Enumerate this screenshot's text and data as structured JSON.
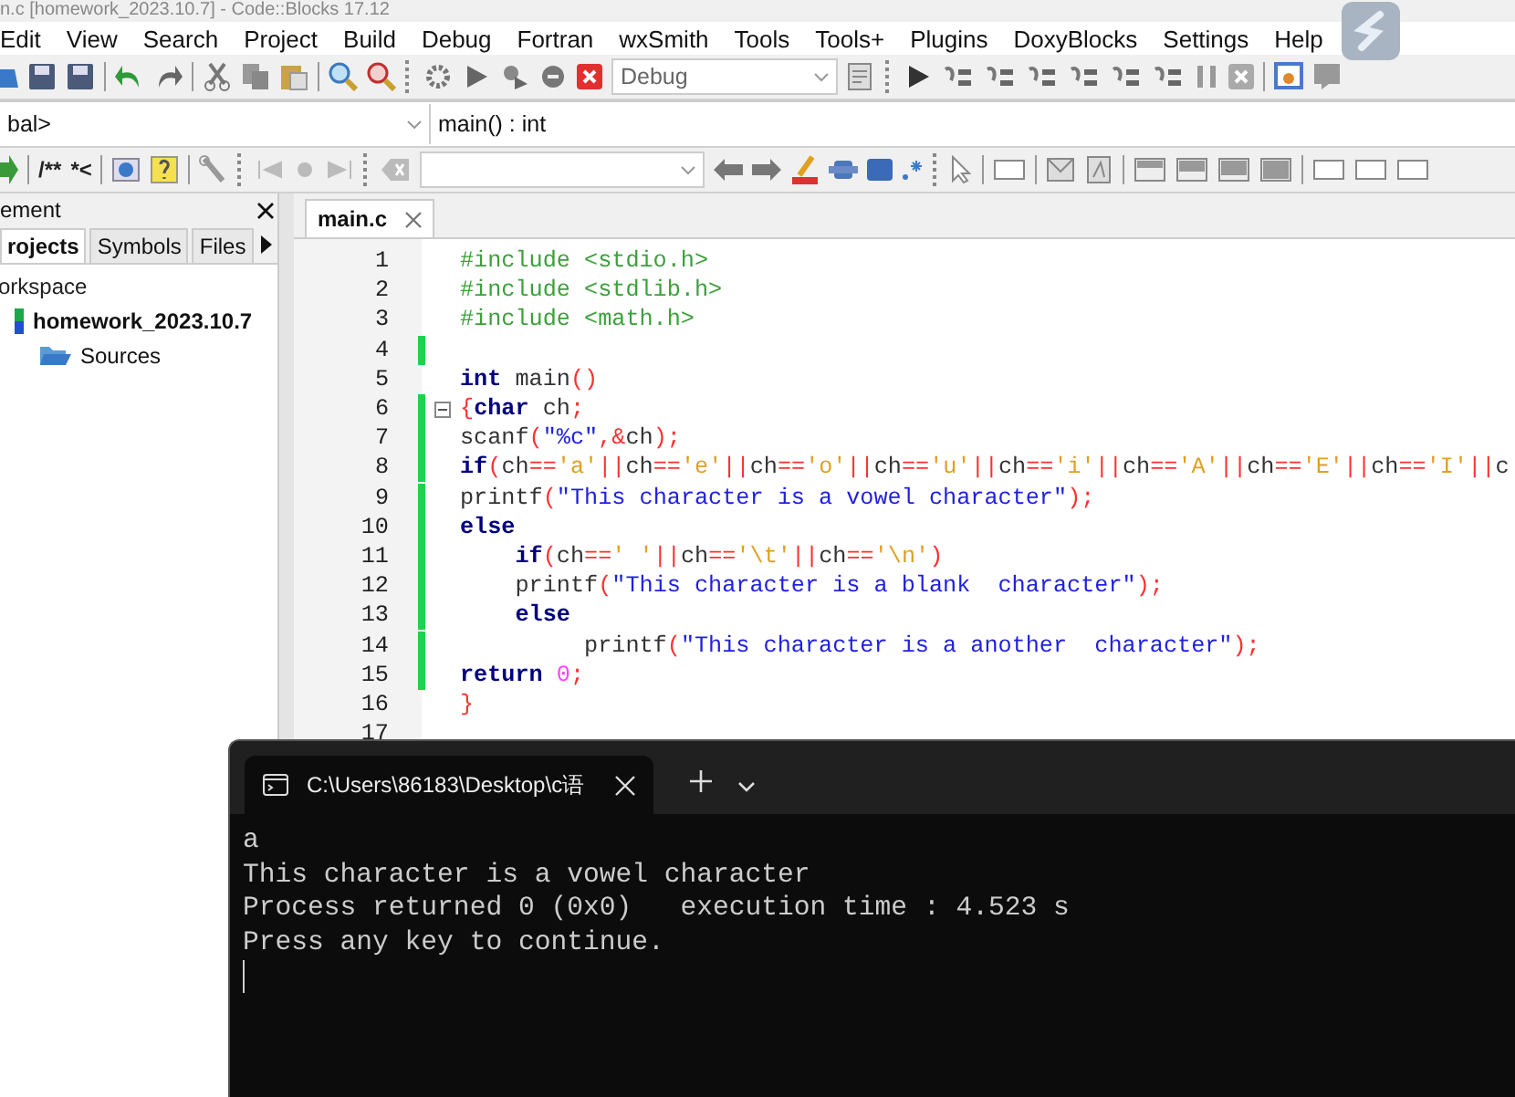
{
  "window": {
    "title": "n.c [homework_2023.10.7] - Code::Blocks 17.12"
  },
  "menu": [
    "Edit",
    "View",
    "Search",
    "Project",
    "Build",
    "Debug",
    "Fortran",
    "wxSmith",
    "Tools",
    "Tools+",
    "Plugins",
    "DoxyBlocks",
    "Settings",
    "Help"
  ],
  "toolbar": {
    "build_target": "Debug",
    "scope": "bal>",
    "function": "main() : int",
    "doxy_buttons": [
      "/**",
      "*<"
    ]
  },
  "management": {
    "title": "ement",
    "tabs": [
      {
        "label": "rojects",
        "selected": true
      },
      {
        "label": "Symbols",
        "selected": false
      },
      {
        "label": "Files",
        "selected": false
      }
    ],
    "tree": [
      {
        "label": "orkspace",
        "kind": "workspace",
        "children": [
          {
            "label": "homework_2023.10.7",
            "kind": "project",
            "children": [
              {
                "label": "Sources",
                "kind": "folder"
              }
            ]
          }
        ]
      }
    ]
  },
  "editor": {
    "tabs": [
      {
        "label": "main.c",
        "selected": true
      }
    ],
    "lines": [
      {
        "n": "1",
        "changed": false,
        "fold": false,
        "tokens": [
          {
            "t": "#include <stdio.h>",
            "kind": "pp"
          }
        ]
      },
      {
        "n": "2",
        "changed": false,
        "fold": false,
        "tokens": [
          {
            "t": "#include <stdlib.h>",
            "kind": "pp"
          }
        ]
      },
      {
        "n": "3",
        "changed": false,
        "fold": false,
        "tokens": [
          {
            "t": "#include <math.h>",
            "kind": "pp"
          }
        ]
      },
      {
        "n": "4",
        "changed": true,
        "fold": false
      },
      {
        "n": "5",
        "changed": false,
        "fold": false,
        "tokens": [
          {
            "t": "int",
            "kind": "kw"
          },
          {
            "t": " main",
            "kind": "tx"
          },
          {
            "t": "()",
            "kind": "op"
          }
        ]
      },
      {
        "n": "6",
        "changed": true,
        "fold": true,
        "tokens": [
          {
            "t": "{",
            "kind": "op"
          },
          {
            "t": "char",
            "kind": "kw"
          },
          {
            "t": " ch",
            "kind": "tx"
          },
          {
            "t": ";",
            "kind": "op"
          }
        ]
      },
      {
        "n": "7",
        "changed": true,
        "fold": false,
        "tokens": [
          {
            "t": "scanf",
            "kind": "tx"
          },
          {
            "t": "(",
            "kind": "op"
          },
          {
            "t": "\"%c\"",
            "kind": "str"
          },
          {
            "t": ",&",
            "kind": "op"
          },
          {
            "t": "ch",
            "kind": "tx"
          },
          {
            "t": ");",
            "kind": "op"
          }
        ]
      },
      {
        "n": "8",
        "changed": true,
        "fold": false,
        "tokens": [
          {
            "t": "if",
            "kind": "kw"
          },
          {
            "t": "(",
            "kind": "op"
          },
          {
            "t": "ch",
            "kind": "tx"
          },
          {
            "t": "==",
            "kind": "op"
          },
          {
            "t": "'a'",
            "kind": "chr"
          },
          {
            "t": "||",
            "kind": "op"
          },
          {
            "t": "ch",
            "kind": "tx"
          },
          {
            "t": "==",
            "kind": "op"
          },
          {
            "t": "'e'",
            "kind": "chr"
          },
          {
            "t": "||",
            "kind": "op"
          },
          {
            "t": "ch",
            "kind": "tx"
          },
          {
            "t": "==",
            "kind": "op"
          },
          {
            "t": "'o'",
            "kind": "chr"
          },
          {
            "t": "||",
            "kind": "op"
          },
          {
            "t": "ch",
            "kind": "tx"
          },
          {
            "t": "==",
            "kind": "op"
          },
          {
            "t": "'u'",
            "kind": "chr"
          },
          {
            "t": "||",
            "kind": "op"
          },
          {
            "t": "ch",
            "kind": "tx"
          },
          {
            "t": "==",
            "kind": "op"
          },
          {
            "t": "'i'",
            "kind": "chr"
          },
          {
            "t": "||",
            "kind": "op"
          },
          {
            "t": "ch",
            "kind": "tx"
          },
          {
            "t": "==",
            "kind": "op"
          },
          {
            "t": "'A'",
            "kind": "chr"
          },
          {
            "t": "||",
            "kind": "op"
          },
          {
            "t": "ch",
            "kind": "tx"
          },
          {
            "t": "==",
            "kind": "op"
          },
          {
            "t": "'E'",
            "kind": "chr"
          },
          {
            "t": "||",
            "kind": "op"
          },
          {
            "t": "ch",
            "kind": "tx"
          },
          {
            "t": "==",
            "kind": "op"
          },
          {
            "t": "'I'",
            "kind": "chr"
          },
          {
            "t": "||",
            "kind": "op"
          },
          {
            "t": "c",
            "kind": "tx"
          }
        ]
      },
      {
        "n": "9",
        "changed": true,
        "fold": false,
        "tokens": [
          {
            "t": "printf",
            "kind": "tx"
          },
          {
            "t": "(",
            "kind": "op"
          },
          {
            "t": "\"This character is a vowel character\"",
            "kind": "str"
          },
          {
            "t": ");",
            "kind": "op"
          }
        ]
      },
      {
        "n": "10",
        "changed": true,
        "fold": false,
        "tokens": [
          {
            "t": "else",
            "kind": "kw"
          }
        ]
      },
      {
        "n": "11",
        "changed": true,
        "fold": false,
        "tokens": [
          {
            "t": "    if",
            "kind": "kw"
          },
          {
            "t": "(",
            "kind": "op"
          },
          {
            "t": "ch",
            "kind": "tx"
          },
          {
            "t": "==",
            "kind": "op"
          },
          {
            "t": "' '",
            "kind": "chr"
          },
          {
            "t": "||",
            "kind": "op"
          },
          {
            "t": "ch",
            "kind": "tx"
          },
          {
            "t": "==",
            "kind": "op"
          },
          {
            "t": "'\\t'",
            "kind": "chr"
          },
          {
            "t": "||",
            "kind": "op"
          },
          {
            "t": "ch",
            "kind": "tx"
          },
          {
            "t": "==",
            "kind": "op"
          },
          {
            "t": "'\\n'",
            "kind": "chr"
          },
          {
            "t": ")",
            "kind": "op"
          }
        ]
      },
      {
        "n": "12",
        "changed": true,
        "fold": false,
        "tokens": [
          {
            "t": "    printf",
            "kind": "tx"
          },
          {
            "t": "(",
            "kind": "op"
          },
          {
            "t": "\"This character is a blank  character\"",
            "kind": "str"
          },
          {
            "t": ");",
            "kind": "op"
          }
        ]
      },
      {
        "n": "13",
        "changed": true,
        "fold": false,
        "tokens": [
          {
            "t": "    else",
            "kind": "kw"
          }
        ]
      },
      {
        "n": "14",
        "changed": true,
        "fold": false,
        "tokens": [
          {
            "t": "         printf",
            "kind": "tx"
          },
          {
            "t": "(",
            "kind": "op"
          },
          {
            "t": "\"This character is a another  character\"",
            "kind": "str"
          },
          {
            "t": ");",
            "kind": "op"
          }
        ]
      },
      {
        "n": "15",
        "changed": true,
        "fold": false,
        "tokens": [
          {
            "t": "return",
            "kind": "kw"
          },
          {
            "t": " 0",
            "kind": "num"
          },
          {
            "t": ";",
            "kind": "op"
          }
        ]
      },
      {
        "n": "16",
        "changed": false,
        "fold": false,
        "tokens": [
          {
            "t": "}",
            "kind": "op"
          }
        ]
      },
      {
        "n": "17",
        "changed": false,
        "fold": false
      }
    ]
  },
  "terminal": {
    "tab_title": "C:\\Users\\86183\\Desktop\\c语",
    "output": [
      "a",
      "This character is a vowel character",
      "Process returned 0 (0x0)   execution time : 4.523 s",
      "Press any key to continue."
    ]
  }
}
